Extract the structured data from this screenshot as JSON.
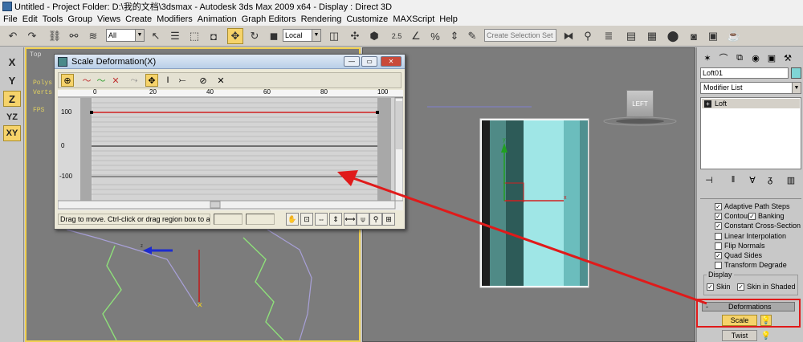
{
  "window": {
    "title": "Untitled    - Project Folder: D:\\我的文档\\3dsmax    - Autodesk 3ds Max  2009 x64    - Display : Direct 3D"
  },
  "menu": [
    "File",
    "Edit",
    "Tools",
    "Group",
    "Views",
    "Create",
    "Modifiers",
    "Animation",
    "Graph Editors",
    "Rendering",
    "Customize",
    "MAXScript",
    "Help"
  ],
  "toolbar": {
    "selection_filter": "All",
    "reference_coord": "Local",
    "named_selection_placeholder": "Create Selection Set",
    "snap_25": "2.5",
    "snap_angle": "∠",
    "snap_percent": "%"
  },
  "axis_buttons": [
    "X",
    "Y",
    "Z",
    "YZ",
    "XY"
  ],
  "viewports": {
    "top_label": "Top",
    "stats": [
      "Polys",
      "Verts",
      "FPS"
    ],
    "viewcube_label": "LEFT"
  },
  "dialog": {
    "title": "Scale Deformation(X)",
    "ruler": [
      "0",
      "20",
      "40",
      "60",
      "80",
      "100"
    ],
    "y_labels": [
      "100",
      "0",
      "-100"
    ],
    "status_text": "Drag to move. Ctrl-click or drag region box to add to s"
  },
  "command_panel": {
    "object_name": "Loft01",
    "color": "#7fd5d5",
    "modifier_list": "Modifier List",
    "stack": [
      "Loft"
    ],
    "skin_options": [
      {
        "label": "Adaptive Path Steps",
        "checked": true
      },
      {
        "label": "Contour",
        "checked": true
      },
      {
        "label": "Banking",
        "checked": true
      },
      {
        "label": "Constant Cross-Section",
        "checked": true
      },
      {
        "label": "Linear Interpolation",
        "checked": false
      },
      {
        "label": "Flip Normals",
        "checked": false
      },
      {
        "label": "Quad Sides",
        "checked": true
      },
      {
        "label": "Transform Degrade",
        "checked": false
      }
    ],
    "display_group": "Display",
    "display_options": [
      {
        "label": "Skin",
        "checked": true
      },
      {
        "label": "Skin in Shaded",
        "checked": true
      }
    ],
    "deformations_header": "Deformations",
    "deformations_collapse": "-",
    "scale_button": "Scale",
    "twist_button": "Twist"
  },
  "colors": {
    "active_button": "#f6d36a",
    "viewport_bg": "#7c7c7c",
    "highlight_red": "#e01a1a",
    "loft_object": "#7fd5d5"
  }
}
